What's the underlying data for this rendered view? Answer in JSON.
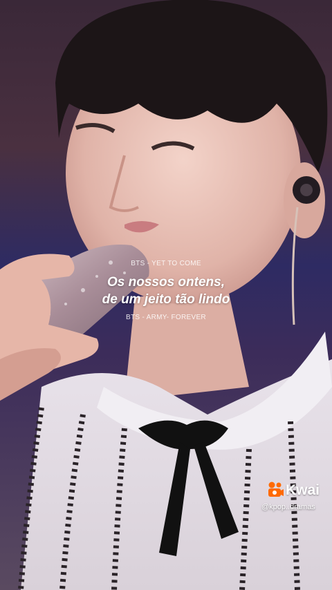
{
  "lyrics": {
    "song_caption": "BTS - YET TO COME",
    "line1": "Os nossos ontens,",
    "line2": "de um jeito tão lindo",
    "artist_caption": "BTS - ARMY- FOREVER"
  },
  "watermark": {
    "app_name": "Kwai",
    "handle": "@kpop..dramas",
    "logo_icon": "kwai-logo-icon",
    "brand_color": "#ff6a00"
  }
}
